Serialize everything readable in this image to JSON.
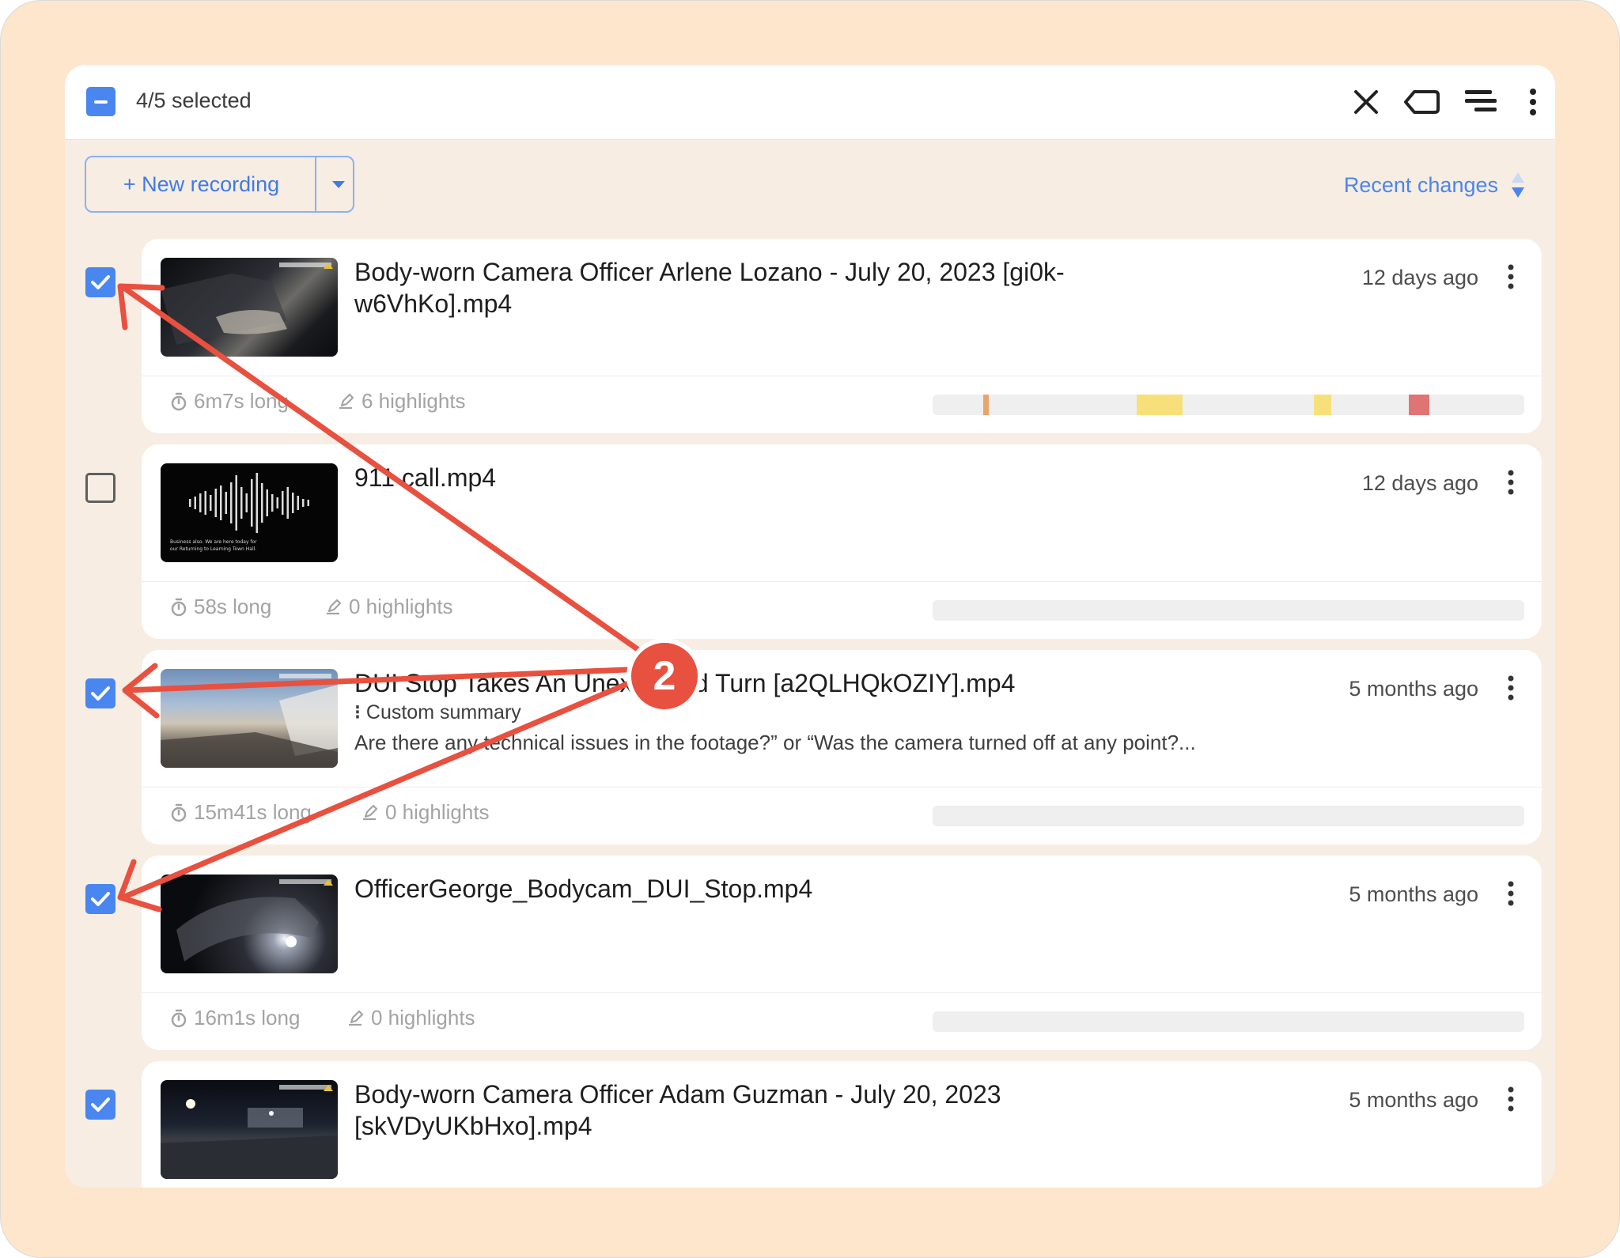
{
  "header": {
    "selected_text": "4/5 selected"
  },
  "toolbar": {
    "new_recording": "+ New recording",
    "sort_label": "Recent changes"
  },
  "recordings": [
    {
      "title": "Body-worn Camera Officer Arlene Lozano - July 20, 2023 [gi0k-w6VhKo].mp4",
      "ago": "12 days ago",
      "length": "6m7s long",
      "highlights": "6 highlights",
      "selected": true
    },
    {
      "title": "911 call.mp4",
      "ago": "12 days ago",
      "length": "58s long",
      "highlights": "0 highlights",
      "selected": false,
      "thumb_caption_line1": "Business also. We are here today for",
      "thumb_caption_line2": "our Returning to Learning Town Hall."
    },
    {
      "title": "DUI Stop Takes An Unexpected Turn [a2QLHQkOZIY].mp4",
      "ago": "5 months ago",
      "summary_label": "Custom summary",
      "summary_text": "Are there any technical issues in the footage?” or “Was the camera turned off at any point?...",
      "length": "15m41s long",
      "highlights": "0 highlights",
      "selected": true
    },
    {
      "title": "OfficerGeorge_Bodycam_DUI_Stop.mp4",
      "ago": "5 months ago",
      "length": "16m1s long",
      "highlights": "0 highlights",
      "selected": true
    },
    {
      "title": "Body-worn Camera Officer Adam Guzman - July 20, 2023 [skVDyUKbHxo].mp4",
      "ago": "5 months ago",
      "selected": true
    }
  ],
  "annotation": {
    "badge": "2"
  },
  "colors": {
    "accent": "#4a86ef",
    "annotation": "#e8503f",
    "highlight_orange": "#e8a46a",
    "highlight_yellow": "#f7e07a",
    "highlight_red": "#e07474"
  }
}
